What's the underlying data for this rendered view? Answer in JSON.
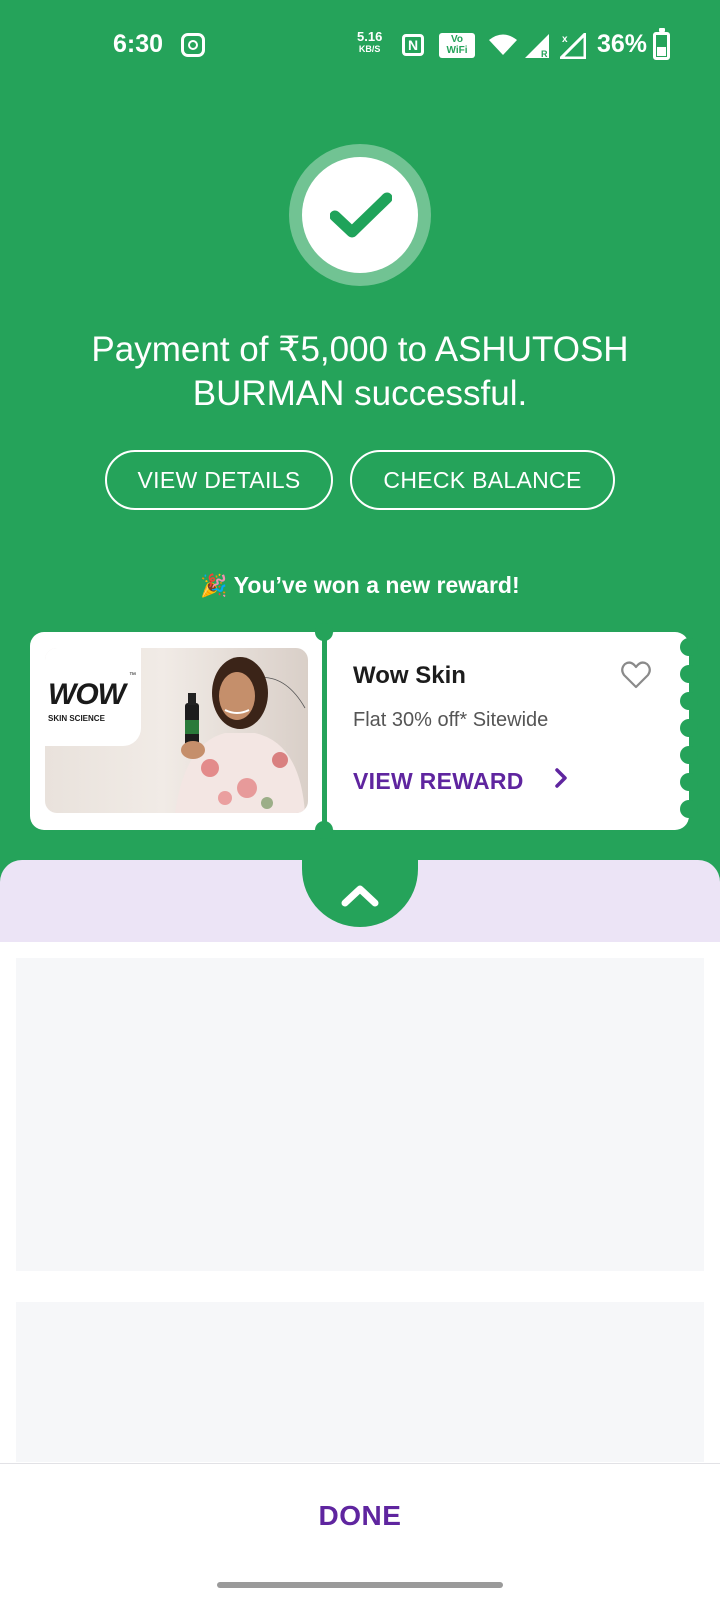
{
  "status_bar": {
    "time": "6:30",
    "net_speed": "5.16",
    "net_unit": "KB/S",
    "nfc": "N",
    "vowifi_line1": "Vo",
    "vowifi_line2": "WiFi",
    "battery": "36%",
    "icons": [
      "instagram-icon",
      "nfc-icon",
      "vowifi-icon",
      "wifi-icon",
      "signal-icon",
      "signal-icon",
      "battery-icon"
    ]
  },
  "payment": {
    "message": "Payment of ₹5,000 to ASHUTOSH BURMAN successful."
  },
  "actions": {
    "view_details": "VIEW DETAILS",
    "check_balance": "CHECK BALANCE"
  },
  "reward": {
    "headline": "You’ve won a new reward!",
    "party_emoji": "🎉",
    "logo_text": "WOW",
    "logo_tm": "™",
    "logo_sub": "SKIN SCIENCE",
    "brand": "Wow Skin",
    "offer": "Flat 30% off* Sitewide",
    "cta": "VIEW REWARD"
  },
  "footer": {
    "done": "DONE"
  },
  "colors": {
    "primary_green": "#25a35a",
    "accent_purple": "#5f259f",
    "sheet_lavender": "#ece4f6"
  }
}
